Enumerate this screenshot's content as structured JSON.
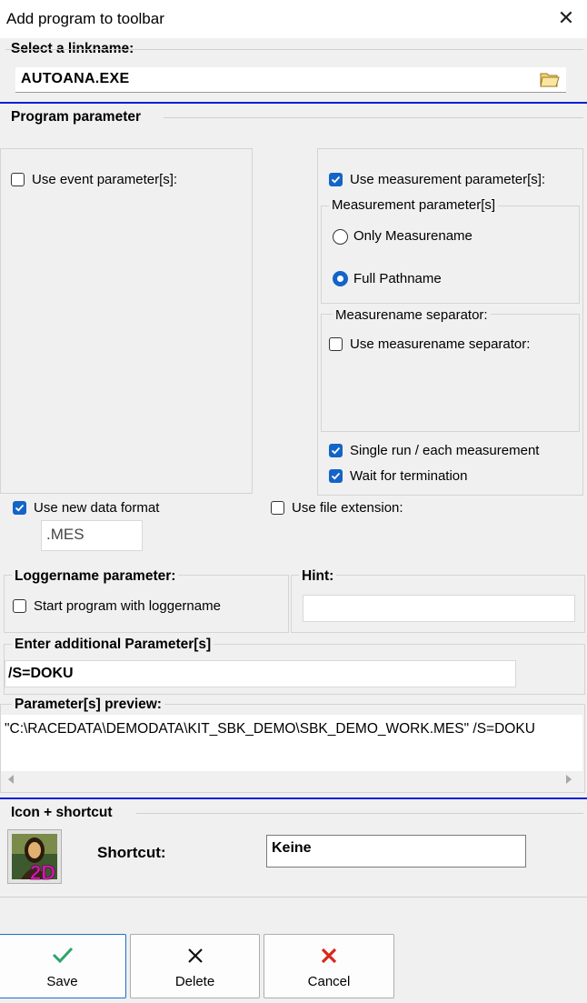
{
  "window": {
    "title": "Add program to toolbar"
  },
  "linkname": {
    "section": "Select a linkname:",
    "value": "AUTOANA.EXE"
  },
  "program": {
    "section": "Program parameter",
    "event_label": "Use event parameter[s]:",
    "measurement_label": "Use measurement parameter[s]:",
    "meas_group": "Measurement parameter[s]",
    "only_name": "Only Measurename",
    "full_path": "Full Pathname",
    "sep_group": "Measurename separator:",
    "use_sep": "Use measurename separator:",
    "single_run": "Single run / each measurement",
    "wait_term": "Wait for termination",
    "new_format": "Use new data format",
    "format_value": ".MES",
    "file_ext": "Use file extension:"
  },
  "logger": {
    "section": "Loggername parameter:",
    "start_label": "Start program with loggername"
  },
  "hint": {
    "section": "Hint:",
    "value": ""
  },
  "additional": {
    "section": "Enter additional Parameter[s]",
    "value": "/S=DOKU"
  },
  "preview": {
    "section": "Parameter[s] preview:",
    "text": "\"C:\\RACEDATA\\DEMODATA\\KIT_SBK_DEMO\\SBK_DEMO_WORK.MES\" /S=DOKU"
  },
  "icon": {
    "section": "Icon + shortcut",
    "shortcut_label": "Shortcut:",
    "shortcut_value": "Keine"
  },
  "buttons": {
    "save": "Save",
    "delete": "Delete",
    "cancel": "Cancel"
  },
  "colors": {
    "accent": "#1464c8",
    "separator": "#0a1fd6",
    "save": "#2ea36a",
    "cancel": "#d9271c"
  }
}
